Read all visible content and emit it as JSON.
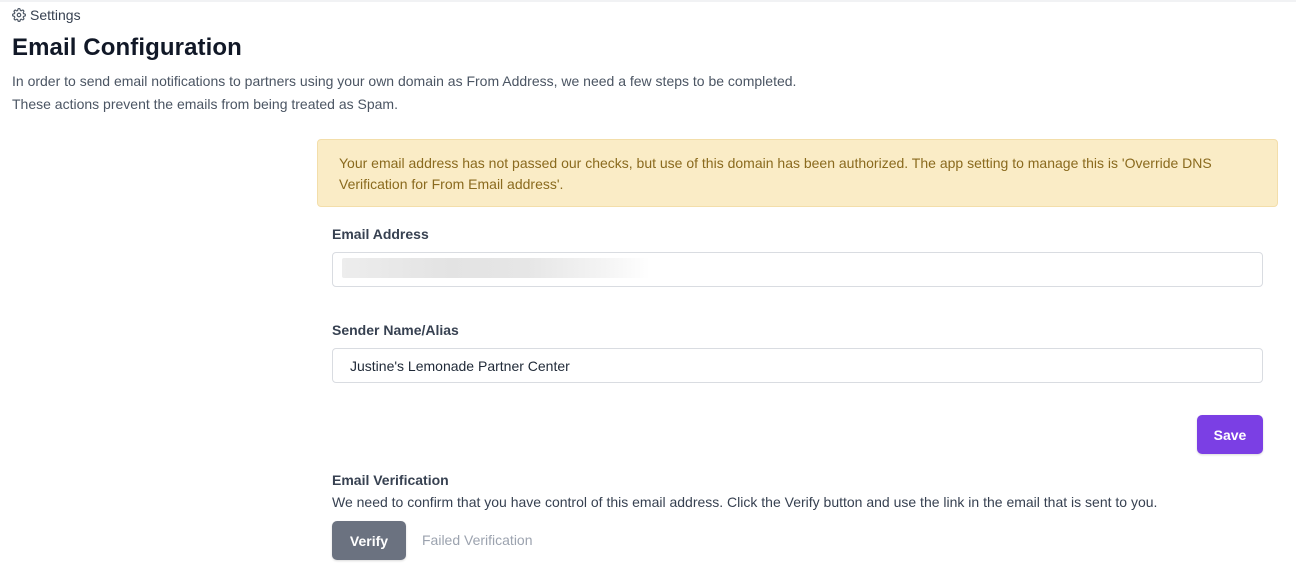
{
  "breadcrumb": {
    "icon": "gear-icon",
    "label": "Settings"
  },
  "page": {
    "title": "Email Configuration",
    "intro_line1": "In order to send email notifications to partners using your own domain as From Address, we need a few steps to be completed.",
    "intro_line2": "These actions prevent the emails from being treated as Spam."
  },
  "alert": {
    "text": "Your email address has not passed our checks, but use of this domain has been authorized. The app setting to manage this is 'Override DNS Verification for From Email address'.",
    "background": "#faecc6",
    "text_color": "#8a6a1e"
  },
  "form": {
    "email_label": "Email Address",
    "email_value": "",
    "sender_label": "Sender Name/Alias",
    "sender_value": "Justine's Lemonade Partner Center",
    "save_label": "Save",
    "save_color": "#7b3fe4"
  },
  "verification": {
    "title": "Email Verification",
    "description": "We need to confirm that you have control of this email address. Click the Verify button and use the link in the email that is sent to you.",
    "verify_label": "Verify",
    "verify_color": "#6b7280",
    "status": "Failed Verification"
  }
}
